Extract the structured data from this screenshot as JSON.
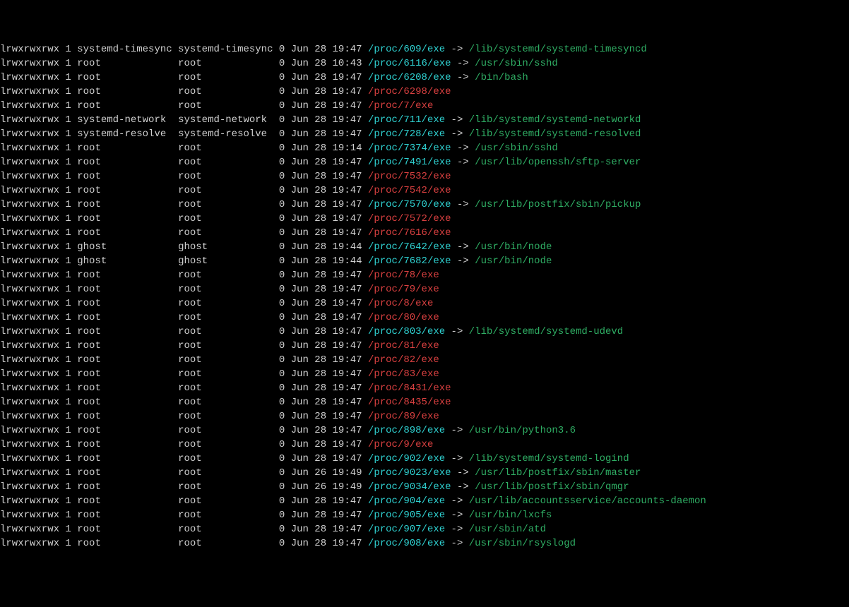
{
  "perm": "lrwxrwxrwx",
  "rows": [
    {
      "user": "systemd-timesync",
      "group": "systemd-timesync",
      "date": "Jun 28 19:47",
      "path": "/proc/609/exe",
      "link": "/lib/systemd/systemd-timesyncd"
    },
    {
      "user": "root",
      "group": "root",
      "date": "Jun 28 10:43",
      "path": "/proc/6116/exe",
      "link": "/usr/sbin/sshd"
    },
    {
      "user": "root",
      "group": "root",
      "date": "Jun 28 19:47",
      "path": "/proc/6208/exe",
      "link": "/bin/bash"
    },
    {
      "user": "root",
      "group": "root",
      "date": "Jun 28 19:47",
      "path": "/proc/6298/exe",
      "broken": true
    },
    {
      "user": "root",
      "group": "root",
      "date": "Jun 28 19:47",
      "path": "/proc/7/exe",
      "broken": true
    },
    {
      "user": "systemd-network",
      "group": "systemd-network",
      "date": "Jun 28 19:47",
      "path": "/proc/711/exe",
      "link": "/lib/systemd/systemd-networkd"
    },
    {
      "user": "systemd-resolve",
      "group": "systemd-resolve",
      "date": "Jun 28 19:47",
      "path": "/proc/728/exe",
      "link": "/lib/systemd/systemd-resolved"
    },
    {
      "user": "root",
      "group": "root",
      "date": "Jun 28 19:14",
      "path": "/proc/7374/exe",
      "link": "/usr/sbin/sshd"
    },
    {
      "user": "root",
      "group": "root",
      "date": "Jun 28 19:47",
      "path": "/proc/7491/exe",
      "link": "/usr/lib/openssh/sftp-server"
    },
    {
      "user": "root",
      "group": "root",
      "date": "Jun 28 19:47",
      "path": "/proc/7532/exe",
      "broken": true
    },
    {
      "user": "root",
      "group": "root",
      "date": "Jun 28 19:47",
      "path": "/proc/7542/exe",
      "broken": true
    },
    {
      "user": "root",
      "group": "root",
      "date": "Jun 28 19:47",
      "path": "/proc/7570/exe",
      "link": "/usr/lib/postfix/sbin/pickup"
    },
    {
      "user": "root",
      "group": "root",
      "date": "Jun 28 19:47",
      "path": "/proc/7572/exe",
      "broken": true
    },
    {
      "user": "root",
      "group": "root",
      "date": "Jun 28 19:47",
      "path": "/proc/7616/exe",
      "broken": true
    },
    {
      "user": "ghost",
      "group": "ghost",
      "date": "Jun 28 19:44",
      "path": "/proc/7642/exe",
      "link": "/usr/bin/node"
    },
    {
      "user": "ghost",
      "group": "ghost",
      "date": "Jun 28 19:44",
      "path": "/proc/7682/exe",
      "link": "/usr/bin/node"
    },
    {
      "user": "root",
      "group": "root",
      "date": "Jun 28 19:47",
      "path": "/proc/78/exe",
      "broken": true
    },
    {
      "user": "root",
      "group": "root",
      "date": "Jun 28 19:47",
      "path": "/proc/79/exe",
      "broken": true
    },
    {
      "user": "root",
      "group": "root",
      "date": "Jun 28 19:47",
      "path": "/proc/8/exe",
      "broken": true
    },
    {
      "user": "root",
      "group": "root",
      "date": "Jun 28 19:47",
      "path": "/proc/80/exe",
      "broken": true
    },
    {
      "user": "root",
      "group": "root",
      "date": "Jun 28 19:47",
      "path": "/proc/803/exe",
      "link": "/lib/systemd/systemd-udevd"
    },
    {
      "user": "root",
      "group": "root",
      "date": "Jun 28 19:47",
      "path": "/proc/81/exe",
      "broken": true
    },
    {
      "user": "root",
      "group": "root",
      "date": "Jun 28 19:47",
      "path": "/proc/82/exe",
      "broken": true
    },
    {
      "user": "root",
      "group": "root",
      "date": "Jun 28 19:47",
      "path": "/proc/83/exe",
      "broken": true
    },
    {
      "user": "root",
      "group": "root",
      "date": "Jun 28 19:47",
      "path": "/proc/8431/exe",
      "broken": true
    },
    {
      "user": "root",
      "group": "root",
      "date": "Jun 28 19:47",
      "path": "/proc/8435/exe",
      "broken": true
    },
    {
      "user": "root",
      "group": "root",
      "date": "Jun 28 19:47",
      "path": "/proc/89/exe",
      "broken": true
    },
    {
      "user": "root",
      "group": "root",
      "date": "Jun 28 19:47",
      "path": "/proc/898/exe",
      "link": "/usr/bin/python3.6"
    },
    {
      "user": "root",
      "group": "root",
      "date": "Jun 28 19:47",
      "path": "/proc/9/exe",
      "broken": true
    },
    {
      "user": "root",
      "group": "root",
      "date": "Jun 28 19:47",
      "path": "/proc/902/exe",
      "link": "/lib/systemd/systemd-logind"
    },
    {
      "user": "root",
      "group": "root",
      "date": "Jun 26 19:49",
      "path": "/proc/9023/exe",
      "link": "/usr/lib/postfix/sbin/master"
    },
    {
      "user": "root",
      "group": "root",
      "date": "Jun 26 19:49",
      "path": "/proc/9034/exe",
      "link": "/usr/lib/postfix/sbin/qmgr"
    },
    {
      "user": "root",
      "group": "root",
      "date": "Jun 28 19:47",
      "path": "/proc/904/exe",
      "link": "/usr/lib/accountsservice/accounts-daemon"
    },
    {
      "user": "root",
      "group": "root",
      "date": "Jun 28 19:47",
      "path": "/proc/905/exe",
      "link": "/usr/bin/lxcfs"
    },
    {
      "user": "root",
      "group": "root",
      "date": "Jun 28 19:47",
      "path": "/proc/907/exe",
      "link": "/usr/sbin/atd"
    },
    {
      "user": "root",
      "group": "root",
      "date": "Jun 28 19:47",
      "path": "/proc/908/exe",
      "link": "/usr/sbin/rsyslogd"
    }
  ]
}
